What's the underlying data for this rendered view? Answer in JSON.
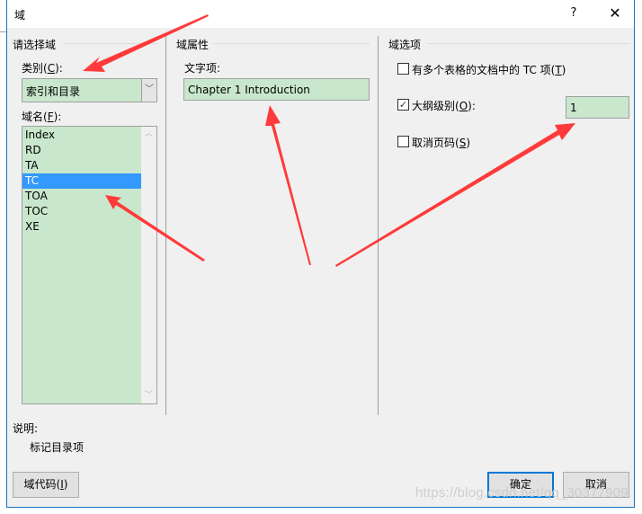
{
  "dialog": {
    "title": "域",
    "help_label": "?",
    "close_label": "✕"
  },
  "left_panel": {
    "group_title": "请选择域",
    "category_label": "类别(C):",
    "category_value": "索引和目录",
    "field_names_label": "域名(F):",
    "field_names": [
      "Index",
      "RD",
      "TA",
      "TC",
      "TOA",
      "TOC",
      "XE"
    ],
    "selected_field": "TC"
  },
  "middle_panel": {
    "group_title": "域属性",
    "text_entry_label": "文字项:",
    "text_entry_value": "Chapter 1 Introduction"
  },
  "right_panel": {
    "group_title": "域选项",
    "options": [
      {
        "label": "有多个表格的文档中的 TC 项(T)",
        "checked": false
      },
      {
        "label": "大纲级别(O):",
        "checked": true
      },
      {
        "label": "取消页码(S)",
        "checked": false
      }
    ],
    "outline_level_value": "1"
  },
  "description": {
    "label": "说明:",
    "text": "标记目录项"
  },
  "buttons": {
    "field_codes": "域代码(I)",
    "ok": "确定",
    "cancel": "取消"
  },
  "icons": {
    "dropdown": "chevron-down-icon",
    "scroll_up": "chevron-up-icon",
    "scroll_down": "chevron-down-icon",
    "checkmark": "checkmark-icon",
    "close": "close-icon",
    "help": "help-icon"
  },
  "annotations": {
    "arrow_color": "#ff3333",
    "arrow_count": 4
  },
  "watermark": "https://blog.csdn.net/qq_30377909",
  "colors": {
    "field_background": "#c9e7cc",
    "selection": "#3399ff",
    "window_border": "#1a73c8",
    "dialog_background": "#f0f0f0"
  }
}
